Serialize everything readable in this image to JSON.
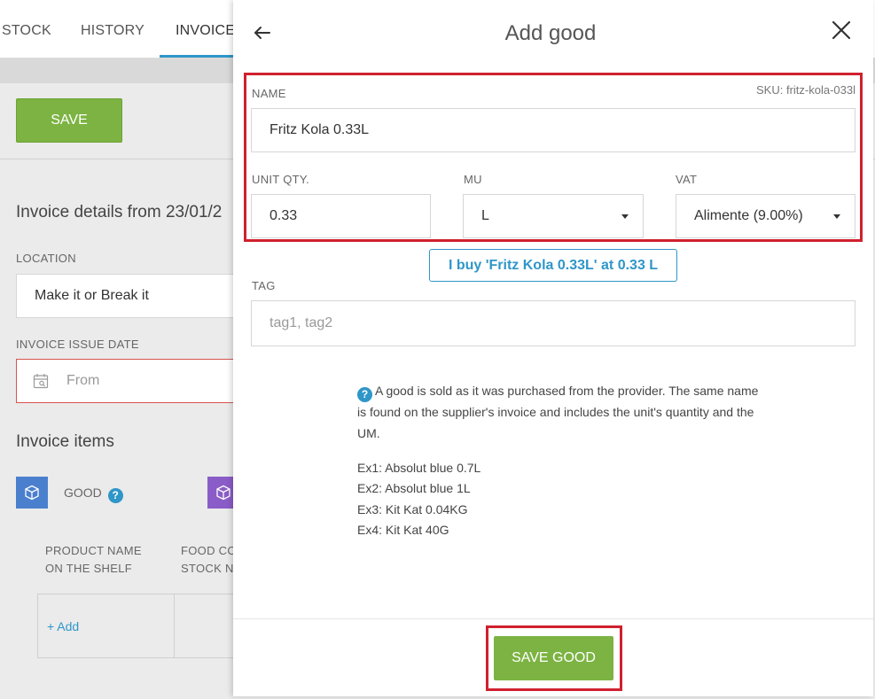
{
  "background": {
    "tabs": [
      "STOCK",
      "HISTORY",
      "INVOICE"
    ],
    "save_label": "SAVE",
    "invoice_heading": "Invoice details from 23/01/2",
    "location_label": "LOCATION",
    "location_value": "Make it or Break it",
    "issue_date_label": "INVOICE ISSUE DATE",
    "issue_date_placeholder": "From",
    "items_heading": "Invoice items",
    "good_label": "GOOD",
    "help_glyph": "?",
    "col_product_name": "PRODUCT NAME\nON THE SHELF",
    "col_food_cost": "FOOD CO\nSTOCK N",
    "add_link": "+ Add"
  },
  "modal": {
    "title": "Add good",
    "name_label": "NAME",
    "sku": "SKU: fritz-kola-033l",
    "name_value": "Fritz Kola 0.33L",
    "unit_qty_label": "UNIT QTY.",
    "unit_qty_value": "0.33",
    "mu_label": "MU",
    "mu_value": "L",
    "vat_label": "VAT",
    "vat_value": "Alimente (9.00%)",
    "hint": "I buy 'Fritz Kola 0.33L' at 0.33 L",
    "tag_label": "TAG",
    "tag_placeholder": "tag1, tag2",
    "info_text": "A good is sold as it was purchased from the provider. The same name is found on the supplier's invoice and includes the unit's quantity and the UM.",
    "examples": [
      "Ex1: Absolut blue 0.7L",
      "Ex2: Absolut blue 1L",
      "Ex3: Kit Kat 0.04KG",
      "Ex4: Kit Kat 40G"
    ],
    "save_button": "SAVE GOOD"
  },
  "colors": {
    "accent": "#2f96c8",
    "save_green": "#7cb342",
    "highlight_red": "#d0202e"
  }
}
